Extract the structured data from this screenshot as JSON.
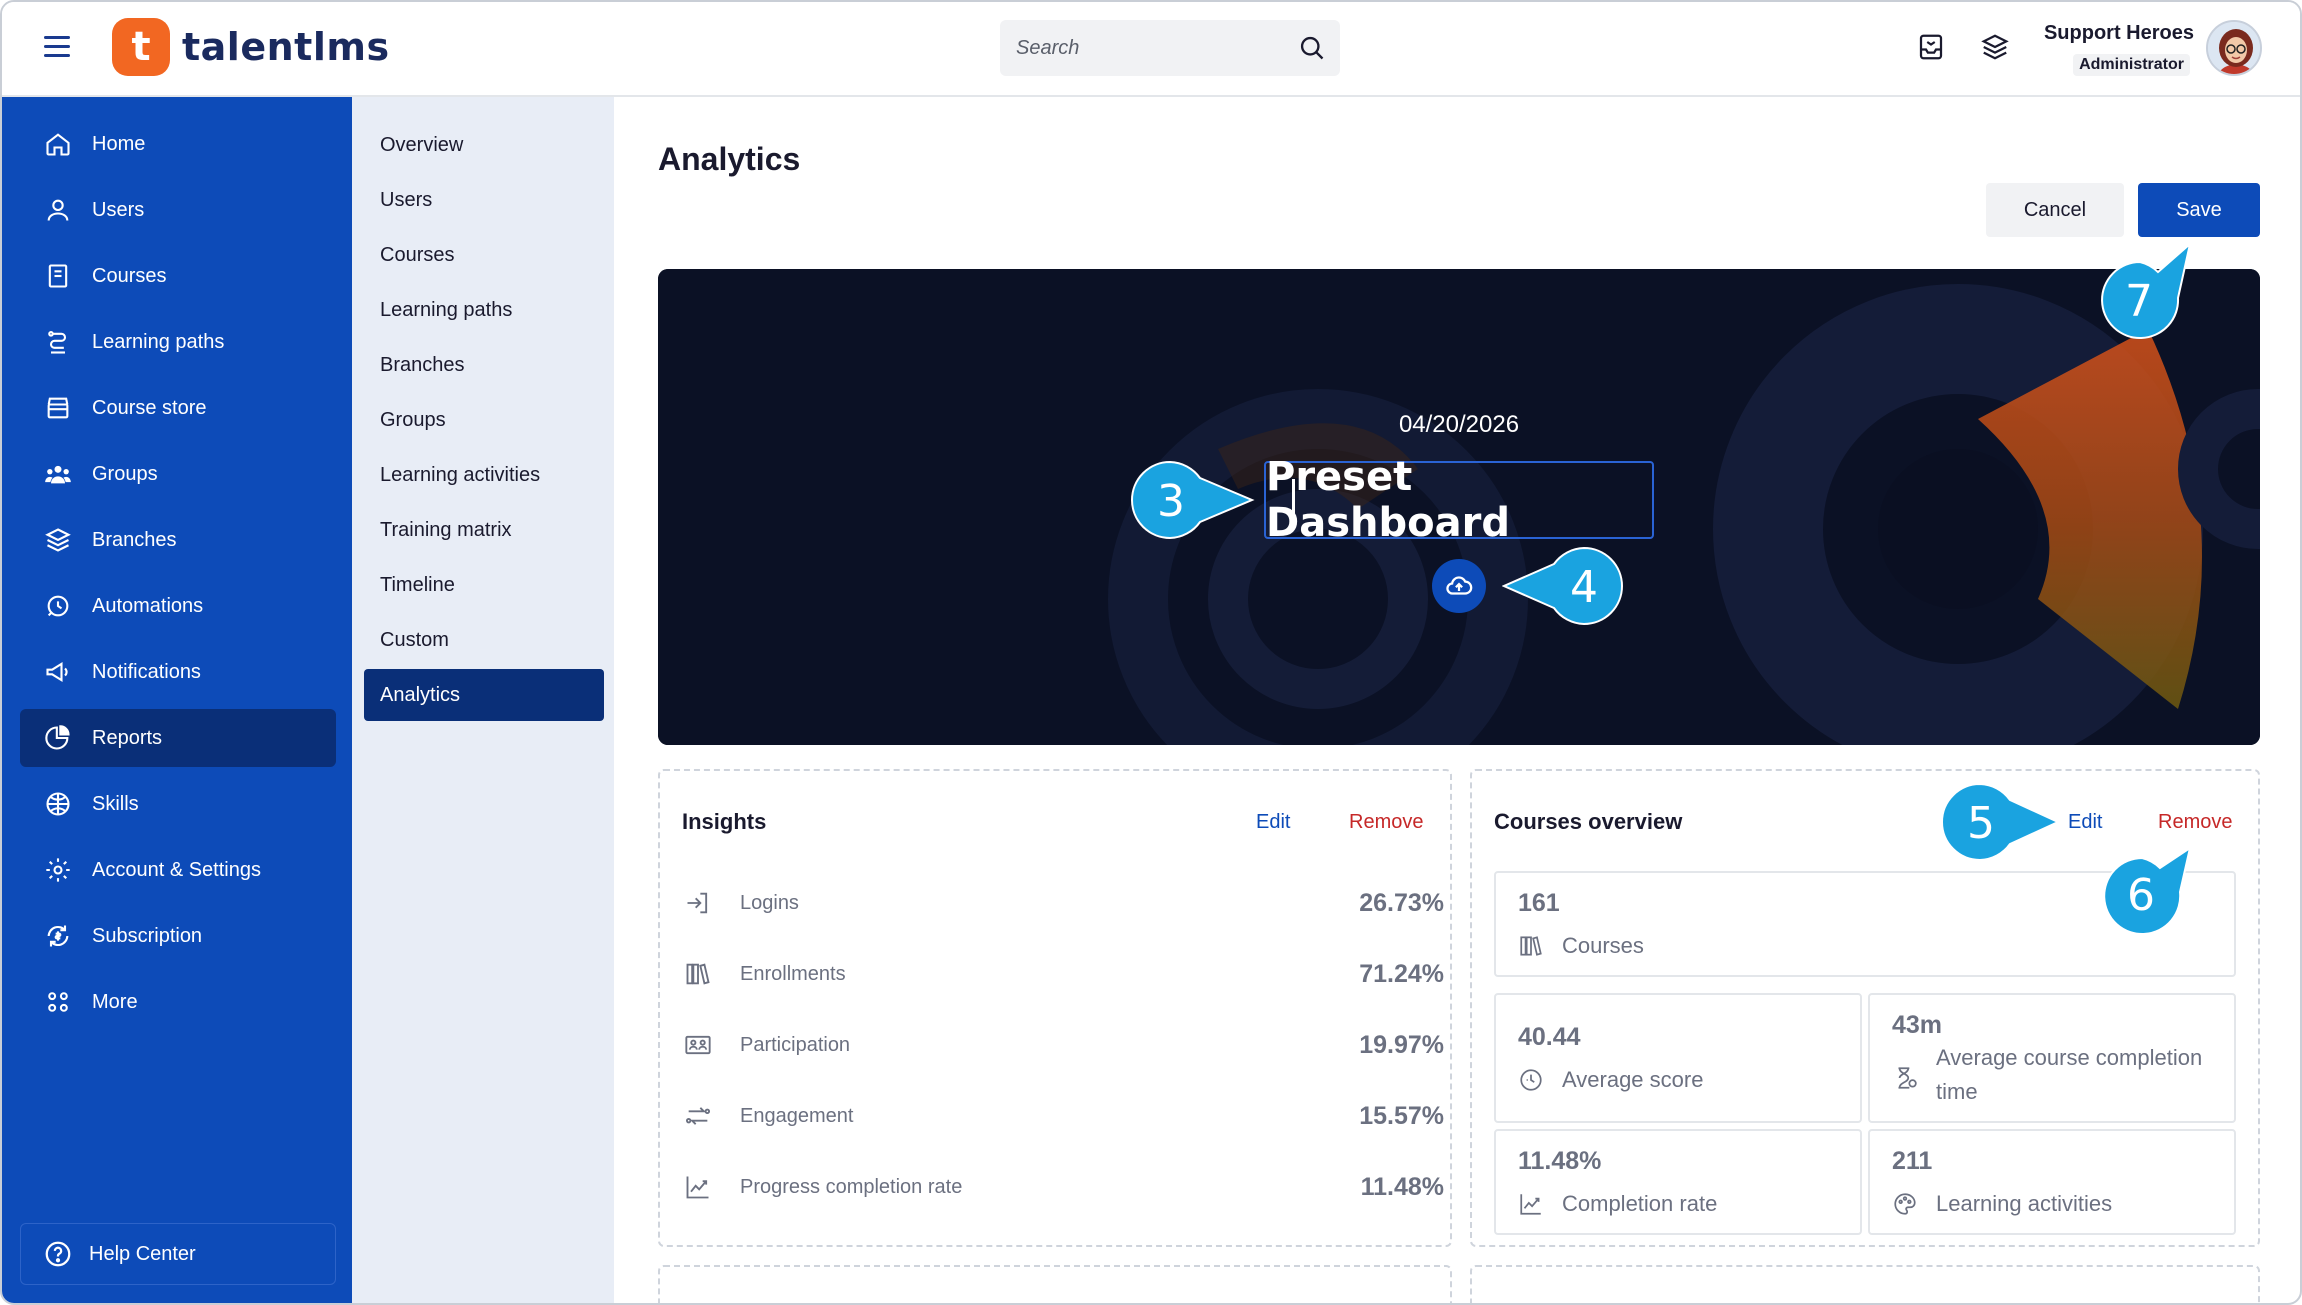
{
  "header": {
    "brand": "talentlms",
    "brand_mark": "t",
    "search_placeholder": "Search",
    "user_name": "Support Heroes",
    "user_role": "Administrator"
  },
  "sidebar": {
    "items": [
      {
        "label": "Home",
        "icon": "home-icon"
      },
      {
        "label": "Users",
        "icon": "user-icon"
      },
      {
        "label": "Courses",
        "icon": "book-icon"
      },
      {
        "label": "Learning paths",
        "icon": "path-icon"
      },
      {
        "label": "Course store",
        "icon": "store-icon"
      },
      {
        "label": "Groups",
        "icon": "group-icon"
      },
      {
        "label": "Branches",
        "icon": "layers-icon"
      },
      {
        "label": "Automations",
        "icon": "automation-icon"
      },
      {
        "label": "Notifications",
        "icon": "megaphone-icon"
      },
      {
        "label": "Reports",
        "icon": "pie-chart-icon"
      },
      {
        "label": "Skills",
        "icon": "skills-icon"
      },
      {
        "label": "Account & Settings",
        "icon": "gear-icon"
      },
      {
        "label": "Subscription",
        "icon": "subscription-icon"
      },
      {
        "label": "More",
        "icon": "grid-icon"
      }
    ],
    "active": "Reports",
    "help_label": "Help Center"
  },
  "subnav": {
    "items": [
      "Overview",
      "Users",
      "Courses",
      "Learning paths",
      "Branches",
      "Groups",
      "Learning activities",
      "Training matrix",
      "Timeline",
      "Custom",
      "Analytics"
    ],
    "active": "Analytics"
  },
  "main": {
    "title": "Analytics",
    "cancel_label": "Cancel",
    "save_label": "Save",
    "banner": {
      "date": "04/20/2026",
      "title": "Preset Dashboard"
    },
    "insights": {
      "title": "Insights",
      "edit_label": "Edit",
      "remove_label": "Remove",
      "rows": [
        {
          "label": "Logins",
          "value": "26.73%"
        },
        {
          "label": "Enrollments",
          "value": "71.24%"
        },
        {
          "label": "Participation",
          "value": "19.97%"
        },
        {
          "label": "Engagement",
          "value": "15.57%"
        },
        {
          "label": "Progress completion rate",
          "value": "11.48%"
        }
      ]
    },
    "courses_overview": {
      "title": "Courses overview",
      "edit_label": "Edit",
      "remove_label": "Remove",
      "stats": [
        {
          "value": "161",
          "label": "Courses"
        },
        {
          "value": "40.44",
          "label": "Average score"
        },
        {
          "value": "43m",
          "label": "Average course completion time"
        },
        {
          "value": "11.48%",
          "label": "Completion rate"
        },
        {
          "value": "211",
          "label": "Learning activities"
        }
      ]
    }
  },
  "callouts": [
    "3",
    "4",
    "5",
    "6",
    "7"
  ],
  "colors": {
    "sidebar_blue": "#0d4bb8",
    "active_navy": "#0a2f78",
    "brand_orange": "#f26722",
    "callout_cyan": "#1aa3e0",
    "remove_red": "#c62828"
  }
}
